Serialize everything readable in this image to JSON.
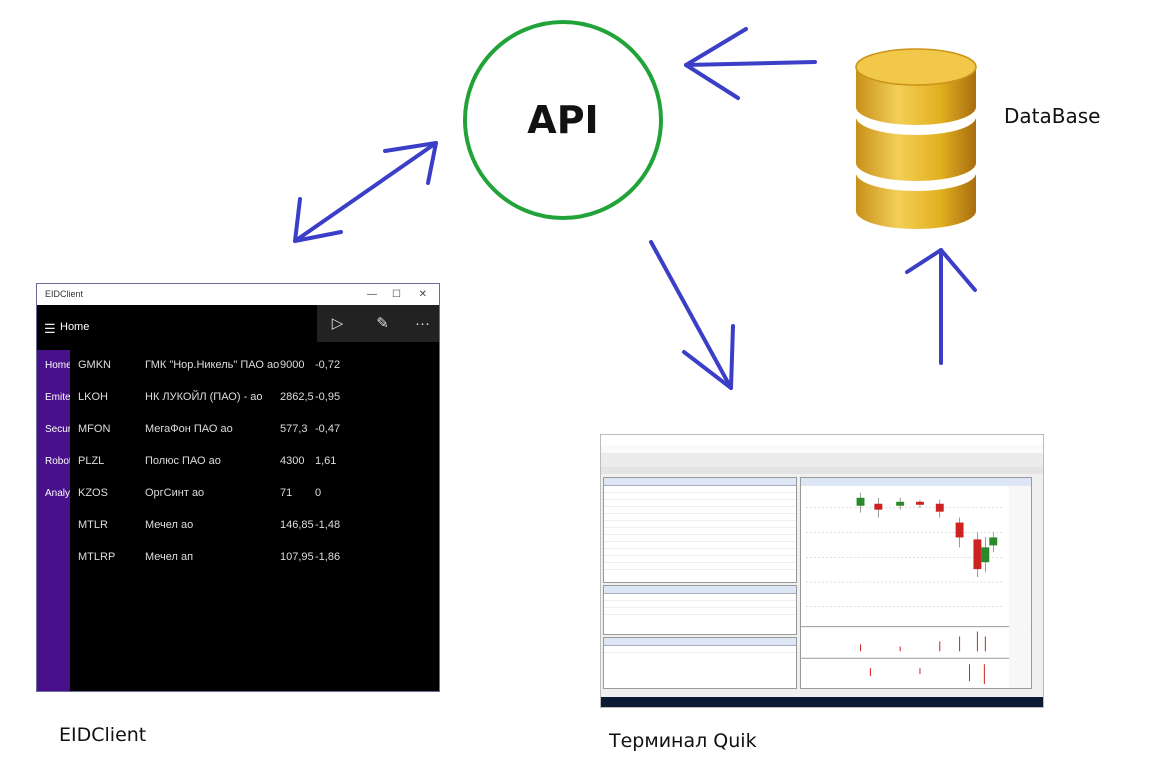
{
  "api": {
    "label": "API"
  },
  "database": {
    "label": "DataBase"
  },
  "eid_caption": "EIDClient",
  "quik_caption": "Терминал Quik",
  "eid_window": {
    "title": "EIDClient",
    "header_title": "Home",
    "toolbar_icons": [
      "play-icon",
      "pencil-icon",
      "more-icon"
    ],
    "nav": [
      "Home",
      "Emite",
      "Secur",
      "Robot",
      "Analy"
    ],
    "rows": [
      {
        "ticker": "GMKN",
        "name": "ГМК \"Нор.Никель\" ПАО ао",
        "price": "9000",
        "change": "-0,72"
      },
      {
        "ticker": "LKOH",
        "name": "НК ЛУКОЙЛ (ПАО) - ао",
        "price": "2862,5",
        "change": "-0,95"
      },
      {
        "ticker": "MFON",
        "name": "МегаФон ПАО ао",
        "price": "577,3",
        "change": "-0,47"
      },
      {
        "ticker": "PLZL",
        "name": "Полюс ПАО ао",
        "price": "4300",
        "change": "1,61"
      },
      {
        "ticker": "KZOS",
        "name": "ОргСинт ао",
        "price": "71",
        "change": "0"
      },
      {
        "ticker": "MTLR",
        "name": "Мечел ао",
        "price": "146,85",
        "change": "-1,48"
      },
      {
        "ticker": "MTLRP",
        "name": "Мечел ап",
        "price": "107,95",
        "change": "-1,86"
      }
    ]
  },
  "colors": {
    "api_circle": "#22a33a",
    "arrow": "#3b3fc8",
    "eid_sidebar": "#48108a",
    "db_gold": "#e2b020"
  }
}
